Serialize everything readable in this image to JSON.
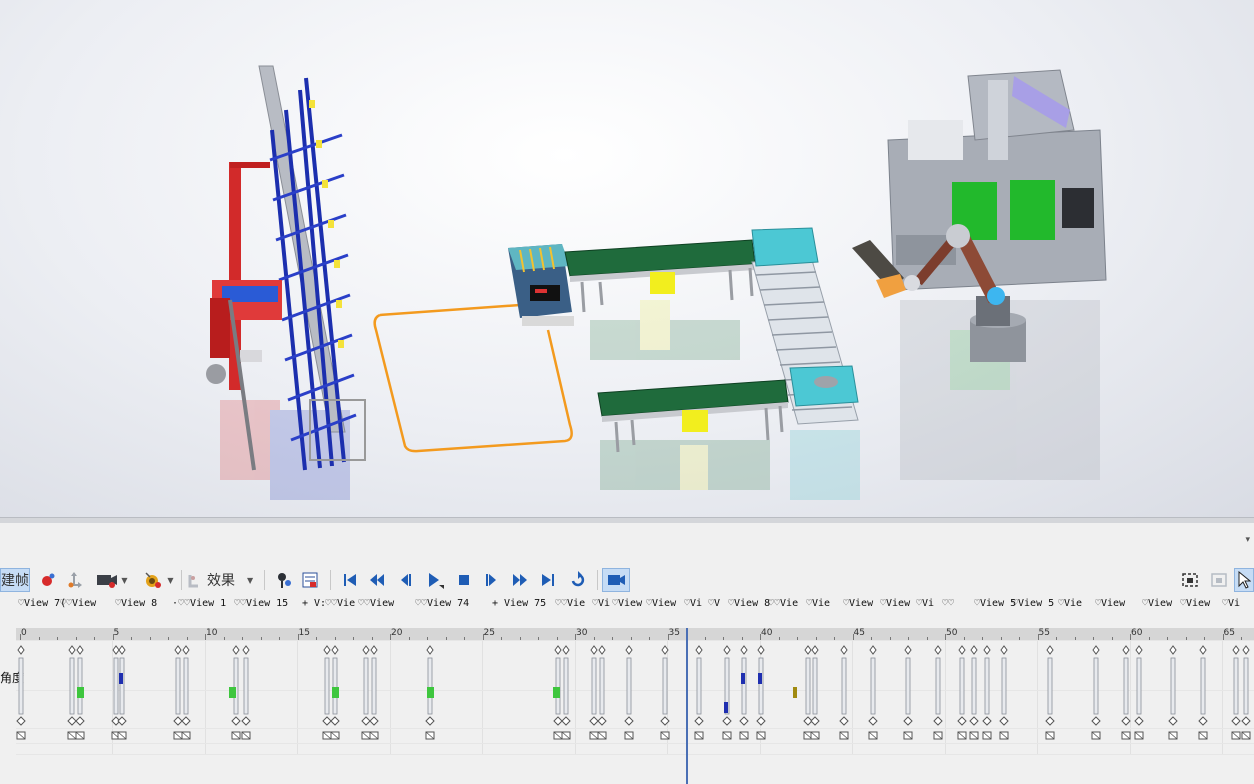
{
  "toolbar": {
    "keyframe_label": "建帧",
    "effects_label": "效果",
    "icons": [
      "record-key-icon",
      "move-arrows-icon",
      "camera-icon",
      "explode-icon",
      "effects-icon",
      "filter-key-icon",
      "properties-icon",
      "first-frame-icon",
      "rewind-icon",
      "step-back-icon",
      "play-icon",
      "stop-icon",
      "step-forward-icon",
      "fast-forward-icon",
      "last-frame-icon",
      "loop-icon",
      "camera-view-icon",
      "fit-capture-icon",
      "capture-disabled-icon",
      "select-pointer-icon"
    ]
  },
  "views": {
    "labels": [
      "♡View 7(",
      "♡♡View",
      "♡View 8",
      "·♡♡View 1",
      "♡♡View 15",
      "+ V:",
      "♡♡Vie",
      "♡♡View",
      "♡♡View 74",
      "+ View 75",
      "♡♡Vie",
      "♡Vi",
      "♡View",
      "♡View",
      "♡Vi",
      "♡V",
      "♡View 8",
      "♡♡Vie",
      "♡Vie",
      "♡View",
      "♡View",
      "♡Vi",
      "♡♡",
      "♡View 5",
      "♡View 5",
      "♡Vie",
      "♡View",
      "♡View",
      "♡View",
      "♡Vi"
    ]
  },
  "timeline": {
    "ruler_labels": [
      "0",
      "5",
      "10",
      "15",
      "20",
      "25",
      "30",
      "35",
      "40",
      "45",
      "50",
      "55",
      "60",
      "65"
    ],
    "row_label": "角度",
    "playhead_time": 36.1
  },
  "colors": {
    "playhead": "#4a6fb5",
    "key_green": "#3ec63e",
    "key_blue": "#1f2fb0",
    "key_olive": "#a08a10",
    "active_button": "#c6dcf5"
  }
}
